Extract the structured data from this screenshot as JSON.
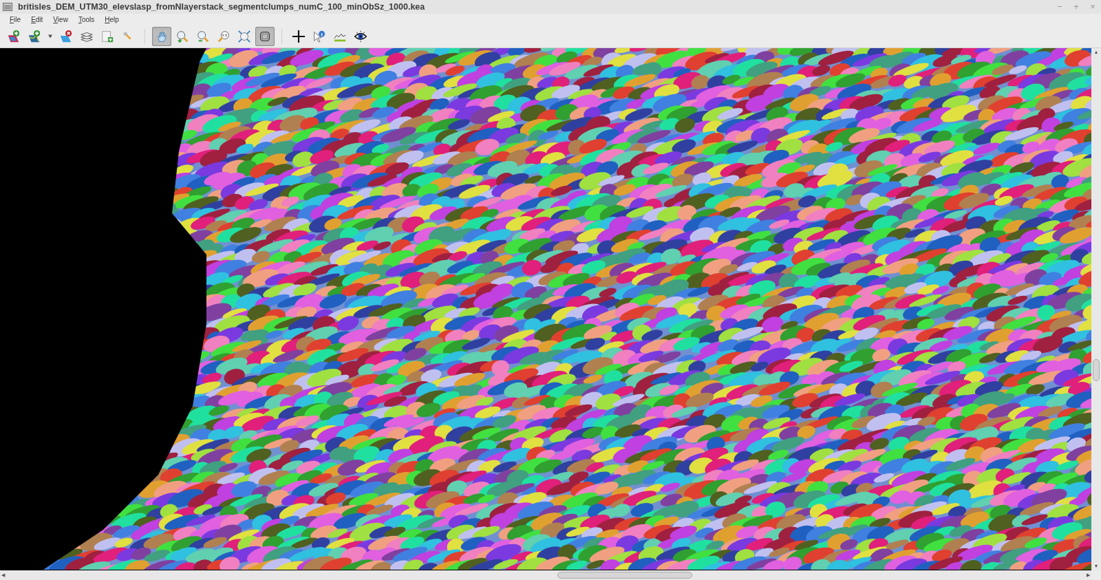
{
  "window": {
    "title": "britisles_DEM_UTM30_elevslasp_fromNlayerstack_segmentclumps_numC_100_minObSz_1000.kea"
  },
  "window_controls": [
    "−",
    "+",
    "×"
  ],
  "vertical_scrollbar": {
    "up": "▲",
    "down": "▼"
  },
  "horizontal_scrollbar": {
    "left": "◀",
    "right": "▶"
  },
  "menu": [
    "File",
    "Edit",
    "View",
    "Tools",
    "Help"
  ],
  "toolbar": [
    {
      "kind": "add-raster",
      "selected": false
    },
    {
      "kind": "add-vector",
      "selected": false
    },
    {
      "kind": "dropdown",
      "selected": false
    },
    {
      "kind": "remove-layer",
      "selected": false
    },
    {
      "kind": "layers",
      "selected": false
    },
    {
      "kind": "new-window",
      "selected": false
    },
    {
      "kind": "properties",
      "selected": false
    },
    {
      "kind": "separator"
    },
    {
      "kind": "pan",
      "selected": true
    },
    {
      "kind": "zoom-in",
      "selected": false
    },
    {
      "kind": "zoom-out",
      "selected": false
    },
    {
      "kind": "zoom-native",
      "selected": false
    },
    {
      "kind": "zoom-full",
      "selected": false
    },
    {
      "kind": "follow",
      "selected": true
    },
    {
      "kind": "separator"
    },
    {
      "kind": "cursor",
      "selected": false
    },
    {
      "kind": "query",
      "selected": false
    },
    {
      "kind": "profile",
      "selected": false
    },
    {
      "kind": "flicker",
      "selected": false
    }
  ]
}
